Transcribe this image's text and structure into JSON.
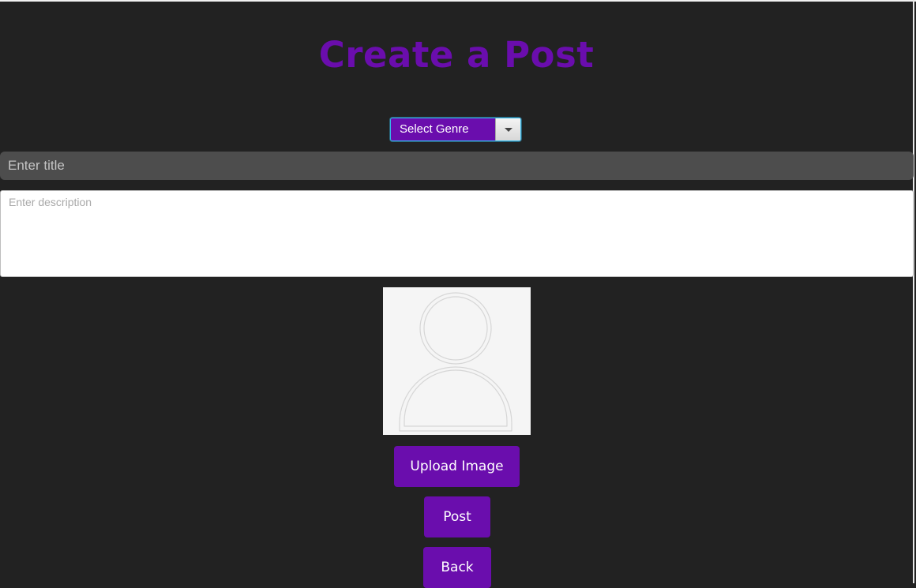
{
  "page": {
    "title": "Create a Post"
  },
  "genre": {
    "selected": "Select Genre"
  },
  "title_field": {
    "value": "",
    "placeholder": "Enter title"
  },
  "description_field": {
    "value": "",
    "placeholder": "Enter description"
  },
  "image_preview": {
    "icon": "user-placeholder-icon"
  },
  "buttons": {
    "upload_label": "Upload Image",
    "post_label": "Post",
    "back_label": "Back"
  },
  "colors": {
    "background": "#222222",
    "accent": "#6a0dad",
    "title_input_bg": "#4d4d4d",
    "focus_ring": "#35b6e6"
  }
}
